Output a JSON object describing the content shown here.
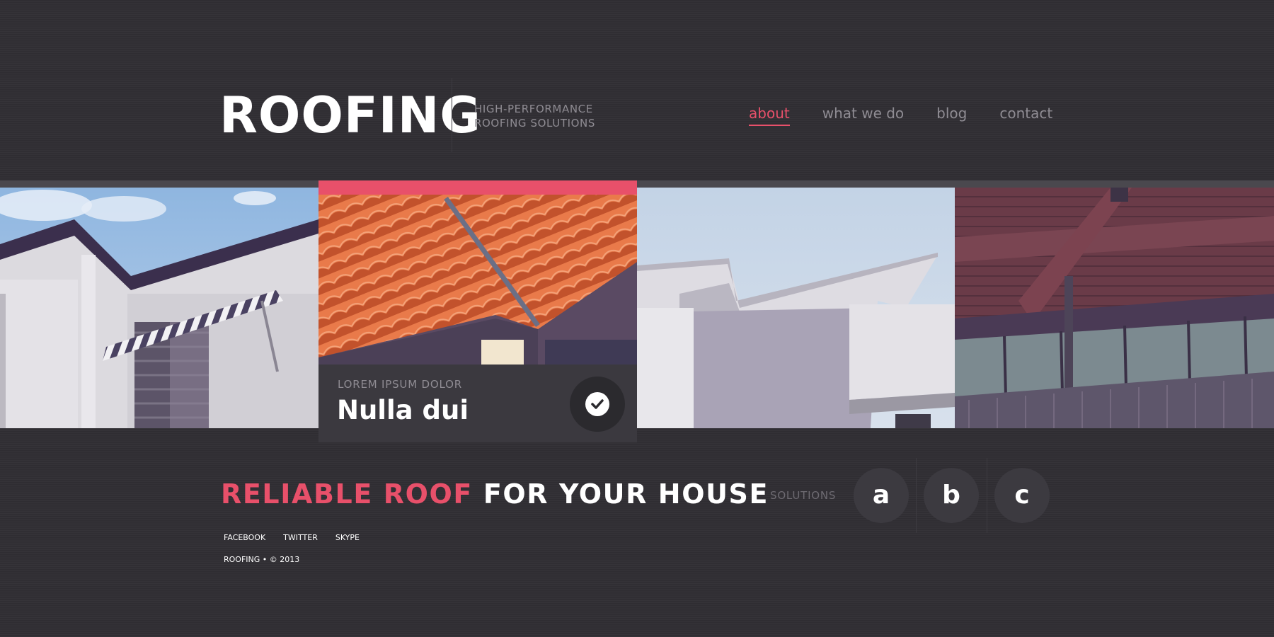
{
  "header": {
    "logo": "ROOFING",
    "tagline_line1": "HIGH-PERFORMANCE",
    "tagline_line2": "ROOFING SOLUTIONS"
  },
  "nav": {
    "items": [
      {
        "label": "about",
        "active": true
      },
      {
        "label": "what we do",
        "active": false
      },
      {
        "label": "blog",
        "active": false
      },
      {
        "label": "contact",
        "active": false
      }
    ]
  },
  "feature": {
    "eyebrow": "LOREM IPSUM DOLOR",
    "title": "Nulla dui",
    "button_icon": "check-icon"
  },
  "headline": {
    "accent": "RELIABLE ROOF",
    "rest": "FOR YOUR HOUSE"
  },
  "social": {
    "items": [
      "FACEBOOK",
      "TWITTER",
      "SKYPE"
    ]
  },
  "footer": {
    "copyright": "ROOFING • © 2013"
  },
  "solutions": {
    "label": "SOLUTIONS",
    "buttons": [
      "a",
      "b",
      "c"
    ]
  },
  "colors": {
    "background": "#302e33",
    "accent": "#e8506a",
    "muted_text": "#8f8c93",
    "panel": "#3b393f",
    "circle": "#3c3a40"
  }
}
